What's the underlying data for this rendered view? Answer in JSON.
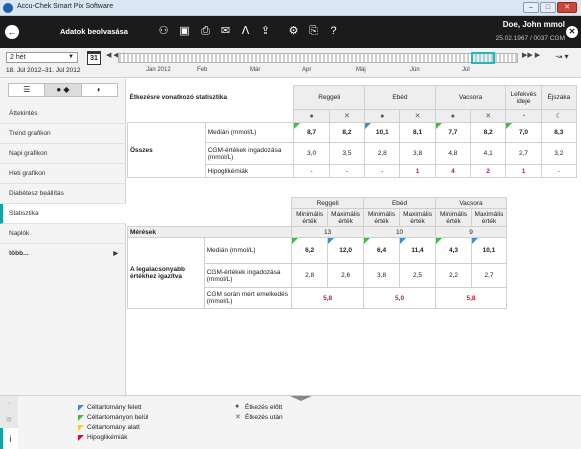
{
  "app": {
    "title": "Accu-Chek Smart Pix Software"
  },
  "window": {
    "minimize": "–",
    "maximize": "□",
    "close": "✕"
  },
  "header": {
    "section": "Adatok beolvasása",
    "patient_name": "Doe, John mmol",
    "patient_id": "25.02.1967 / 0037 CGM"
  },
  "icons": {
    "back": "←",
    "users": "⚇",
    "save": "▣",
    "print": "⎙",
    "mail": "✉",
    "pdf": "ᐱ",
    "export": "⇪",
    "settings": "⚙",
    "device": "⎘",
    "help": "?",
    "close": "✕",
    "calendar": "31",
    "chart_type": "↝ ▾"
  },
  "daterow": {
    "period": "2 hét",
    "range": "18. Júl 2012–31. Júl 2012",
    "nav_back": "◀ ◀◀",
    "nav_fwd": "▶▶ ▶",
    "months": [
      "Jan 2012",
      "Feb",
      "Már",
      "Apr",
      "Máj",
      "Jún",
      "Júl"
    ]
  },
  "sidebar": {
    "tabs": [
      "☰",
      "● ◆",
      "◐"
    ],
    "items": [
      "Áttekintés",
      "Trend grafikon",
      "Napi grafikon",
      "Heti grafikon",
      "Diabétesz beállítás",
      "Statisztika",
      "Naplók",
      "több..."
    ]
  },
  "stats": {
    "title": "Étkezésre vonatkozó statisztika",
    "meals": [
      "Reggeli",
      "Ebéd",
      "Vacsora"
    ],
    "extra_cols": [
      "Lefekvés ideje",
      "Éjszaka"
    ],
    "before_icon": "●",
    "after_icon": "✕",
    "bed_icon": "◔",
    "night_icon": "☾",
    "group": "Összes",
    "rows": [
      {
        "label": "Medián (mmol/L)",
        "values": [
          "8,7",
          "8,2",
          "10,1",
          "8,1",
          "7,7",
          "8,2",
          "7,0",
          "8,3"
        ]
      },
      {
        "label": "CGM-értékek ingadozása (mmol/L)",
        "values": [
          "3,0",
          "3,5",
          "2,8",
          "3,8",
          "4,8",
          "4,1",
          "2,7",
          "3,2"
        ]
      },
      {
        "label": "Hipoglikémiák",
        "values": [
          "-",
          "-",
          "-",
          "1",
          "4",
          "2",
          "1",
          "-"
        ]
      }
    ]
  },
  "minmax": {
    "meals": [
      "Reggeli",
      "Ebéd",
      "Vacsora"
    ],
    "min_label": "Minimális érték",
    "max_label": "Maximális érték",
    "measurements_label": "Mérések",
    "measurements": [
      "13",
      "10",
      "9"
    ],
    "group": "A legalacsonyabb értékhez igazítva",
    "rows": [
      {
        "label": "Medián (mmol/L)",
        "values": [
          "6,2",
          "12,0",
          "6,4",
          "11,4",
          "4,3",
          "10,1"
        ]
      },
      {
        "label": "CGM-értékek ingadozása (mmol/L)",
        "values": [
          "2,8",
          "2,6",
          "3,8",
          "2,5",
          "2,2",
          "2,7"
        ]
      },
      {
        "label": "CGM során mért emelkedés (mmol/L)",
        "values": [
          "5,8",
          "5,0",
          "5,8"
        ]
      }
    ]
  },
  "legend": {
    "above": "Céltartomány felett",
    "within": "Céltartományon belül",
    "below": "Céltartomány alatt",
    "hypo": "Hipoglikémiák",
    "before": "Étkezés előtt",
    "after": "Étkezés után",
    "info_icon": "i",
    "colors": {
      "above": "#3b8fd6",
      "within": "#4ab848",
      "below": "#f3d01b",
      "hypo": "#d0122a"
    }
  }
}
